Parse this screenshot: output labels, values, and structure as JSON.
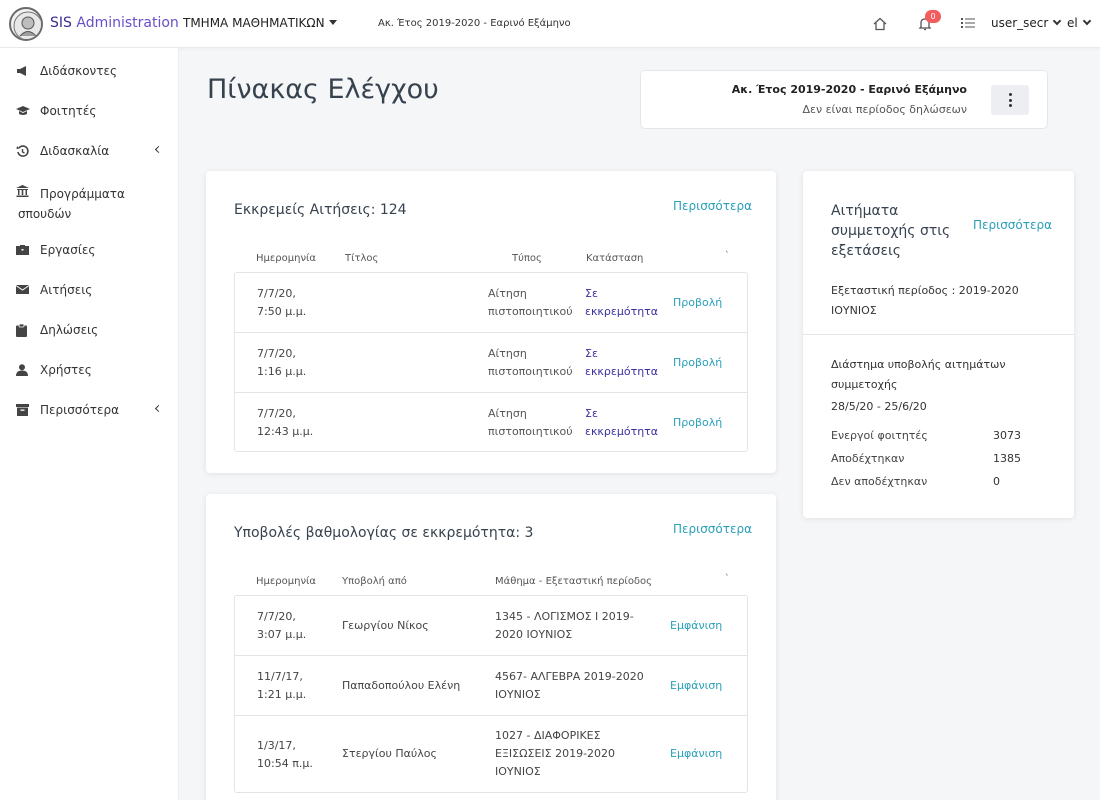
{
  "topbar": {
    "brand_part1": "SIS",
    "brand_part2": " Administration",
    "department": "ΤΜΗΜΑ ΜΑΘΗΜΑΤΙΚΩΝ",
    "period": "Ακ. Έτος 2019-2020 - Εαρινό Εξάμηνο",
    "notification_count": "0",
    "username": "user_secr",
    "language": "el"
  },
  "sidebar": {
    "items": [
      {
        "label": "Διδάσκοντες",
        "icon": "bullhorn-icon"
      },
      {
        "label": "Φοιτητές",
        "icon": "graduation-cap-icon"
      },
      {
        "label": "Διδασκαλία",
        "icon": "history-icon"
      },
      {
        "label": "Προγράμματα σπουδών",
        "icon": "university-icon"
      },
      {
        "label": "Εργασίες",
        "icon": "briefcase-icon"
      },
      {
        "label": "Αιτήσεις",
        "icon": "envelope-icon"
      },
      {
        "label": "Δηλώσεις",
        "icon": "clipboard-icon"
      },
      {
        "label": "Χρήστες",
        "icon": "user-icon"
      },
      {
        "label": "Περισσότερα",
        "icon": "archive-icon"
      }
    ]
  },
  "page": {
    "title": "Πίνακας Ελέγχου",
    "period_card": {
      "title": "Ακ. Έτος 2019-2020 - Εαρινό Εξάμηνο",
      "subtitle": "Δεν είναι περίοδος δηλώσεων"
    }
  },
  "requests": {
    "title": "Εκκρεμείς Αιτήσεις: 124",
    "more": "Περισσότερα",
    "headers": {
      "date": "Ημερομηνία",
      "title": "Τίτλος",
      "type": "Τύπος",
      "status": "Κατάσταση",
      "extra": "`"
    },
    "rows": [
      {
        "date1": "7/7/20,",
        "date2": "7:50 μ.μ.",
        "type1": "Αίτηση",
        "type2": "πιστοποιητικού",
        "status1": "Σε",
        "status2": "εκκρεμότητα",
        "action": "Προβολή"
      },
      {
        "date1": "7/7/20,",
        "date2": "1:16 μ.μ.",
        "type1": "Αίτηση",
        "type2": "πιστοποιητικού",
        "status1": "Σε",
        "status2": "εκκρεμότητα",
        "action": "Προβολή"
      },
      {
        "date1": "7/7/20,",
        "date2": "12:43 μ.μ.",
        "type1": "Αίτηση",
        "type2": "πιστοποιητικού",
        "status1": "Σε",
        "status2": "εκκρεμότητα",
        "action": "Προβολή"
      }
    ]
  },
  "grades": {
    "title": "Υποβολές βαθμολογίας σε εκκρεμότητα: 3",
    "more": "Περισσότερα",
    "headers": {
      "date": "Ημερομηνία",
      "by": "Υποβολή από",
      "course": "Μάθημα - Εξεταστική περίοδος",
      "extra": "`"
    },
    "rows": [
      {
        "date1": "7/7/20,",
        "date2": "3:07 μ.μ.",
        "by": "Γεωργίου Νίκος",
        "course": "1345 - ΛΟΓΙΣΜΟΣ Ι 2019-2020 ΙΟΥΝΙΟΣ",
        "action": "Εμφάνιση"
      },
      {
        "date1": "11/7/17,",
        "date2": "1:21 μ.μ.",
        "by": "Παπαδοπούλου Ελένη",
        "course": "4567- ΑΛΓΕΒΡΑ 2019-2020 ΙΟΥΝΙΟΣ",
        "action": "Εμφάνιση"
      },
      {
        "date1": "1/3/17,",
        "date2": "10:54 π.μ.",
        "by": "Στεργίου Παύλος",
        "course": "1027 - ΔΙΑΦΟΡΙΚΕΣ ΕΞΙΣΩΣΕΙΣ 2019-2020 ΙΟΥΝΙΟΣ",
        "action": "Εμφάνιση"
      }
    ]
  },
  "exams": {
    "title": "Αιτήματα συμμετοχής στις εξετάσεις",
    "more": "Περισσότερα",
    "exam_period": "Εξεταστική περίοδος : 2019-2020 ΙΟΥΝΙΟΣ",
    "submission_label": "Διάστημα υποβολής αιτημάτων συμμετοχής",
    "submission_dates": "28/5/20 - 25/6/20",
    "stats": [
      {
        "label": "Ενεργοί φοιτητές",
        "value": "3073"
      },
      {
        "label": "Αποδέχτηκαν",
        "value": "1385"
      },
      {
        "label": "Δεν αποδέχτηκαν",
        "value": "0"
      }
    ]
  },
  "colors": {
    "accent": "#2aa0b8",
    "brand": "#3d2b8f",
    "badge": "#f25c5c",
    "status": "#3a2fa0"
  }
}
